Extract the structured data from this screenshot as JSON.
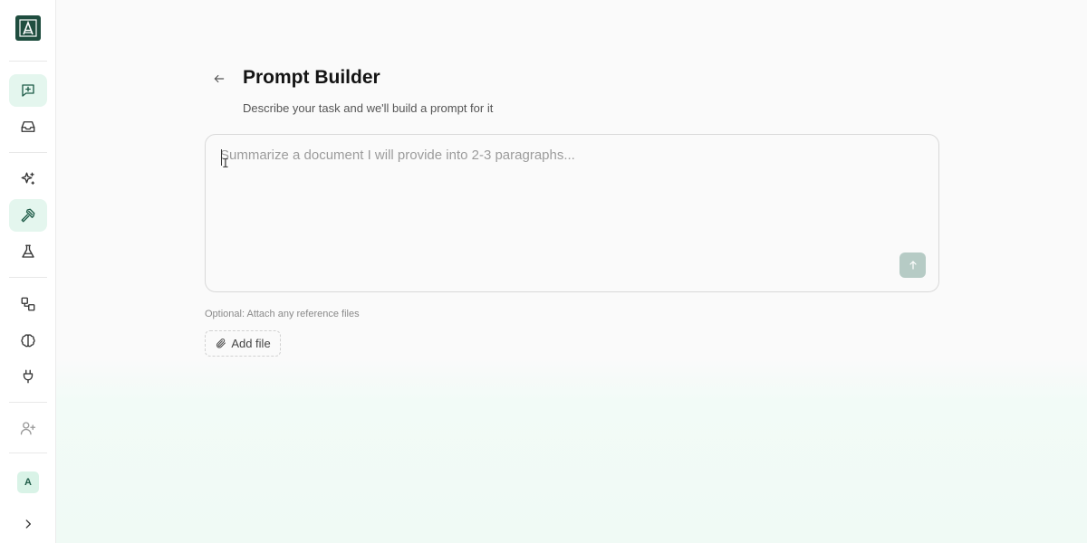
{
  "app": {
    "logo_letter": "A"
  },
  "sidebar": {
    "items": [
      {
        "icon": "message-plus-icon",
        "active": true
      },
      {
        "icon": "inbox-icon",
        "active": false
      },
      {
        "icon": "sparkles-icon",
        "active": false
      },
      {
        "icon": "hammer-icon",
        "active": true
      },
      {
        "icon": "flask-icon",
        "active": false
      },
      {
        "icon": "shapes-icon",
        "active": false
      },
      {
        "icon": "brain-icon",
        "active": false
      },
      {
        "icon": "plug-icon",
        "active": false
      },
      {
        "icon": "user-plus-icon",
        "active": false
      }
    ],
    "avatar_initial": "A",
    "expand_icon": "chevron-right-icon"
  },
  "page": {
    "title": "Prompt Builder",
    "subtitle": "Describe your task and we'll build a prompt for it"
  },
  "prompt": {
    "value": "",
    "placeholder": "Summarize a document I will provide into 2-3 paragraphs..."
  },
  "attachments": {
    "hint": "Optional: Attach any reference files",
    "add_label": "Add file"
  },
  "colors": {
    "brand": "#1f4d3f",
    "active_bg": "#e4f6ee",
    "send_disabled": "#b6cbc5"
  }
}
